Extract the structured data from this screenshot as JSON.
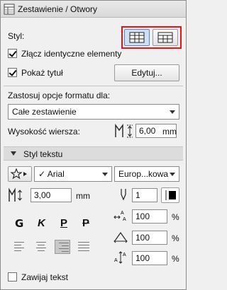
{
  "title": "Zestawienie / Otwory",
  "style_label": "Styl:",
  "merge_label": "Złącz identyczne elementy",
  "show_title_label": "Pokaż tytuł",
  "edit_button": "Edytuj...",
  "apply_format_label": "Zastosuj opcje formatu dla:",
  "apply_format_value": "Całe zestawienie",
  "row_height_label": "Wysokość wiersza:",
  "row_height_value": "6,00",
  "row_height_unit": "mm",
  "text_style_header": "Styl tekstu",
  "font_name": "Arial",
  "encoding": "Europ...kowa",
  "font_size_value": "3,00",
  "font_size_unit": "mm",
  "pen_number": "1",
  "format_buttons": [
    "G",
    "K",
    "P",
    "P"
  ],
  "spacing_values": [
    "100",
    "100",
    "100"
  ],
  "percent": "%",
  "wrap_text_label": "Zawijaj tekst",
  "states": {
    "merge_checked": true,
    "show_title_checked": true,
    "wrap_text_checked": false
  }
}
